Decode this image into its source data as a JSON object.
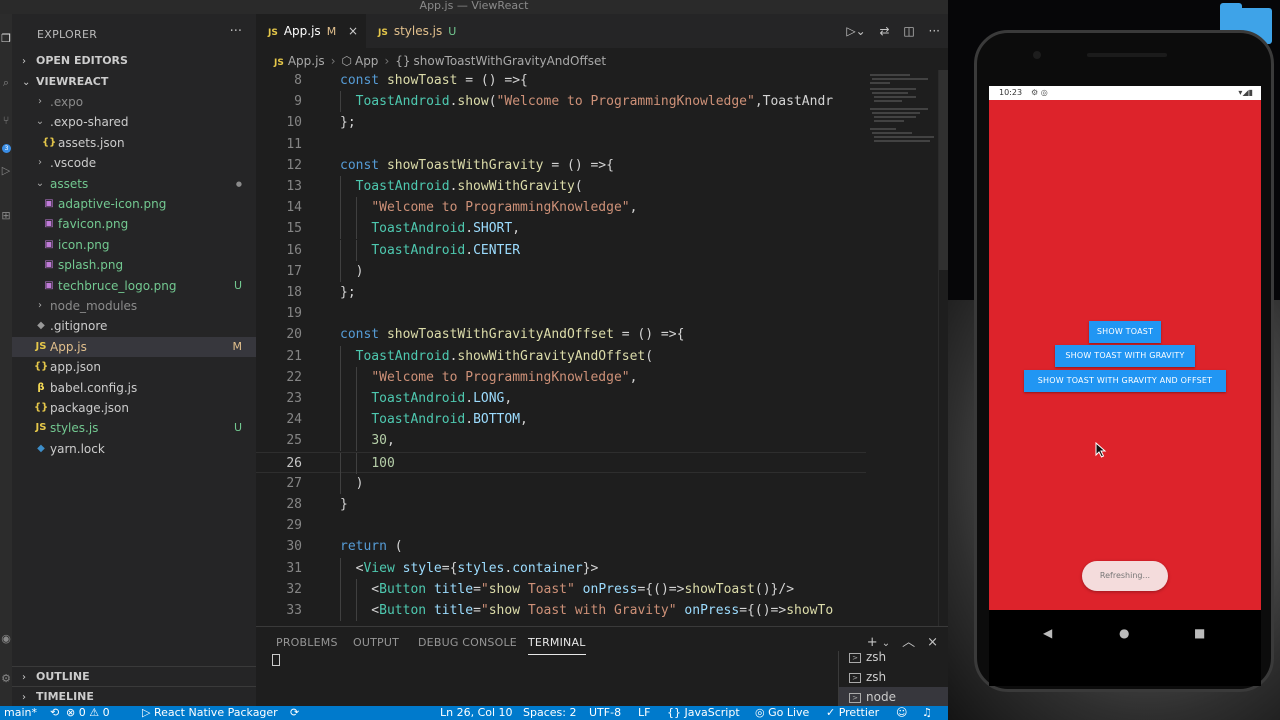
{
  "window_title": "App.js — ViewReact",
  "sidebar": {
    "header": "EXPLORER",
    "more": "···",
    "open_editors": "OPEN EDITORS",
    "project": "VIEWREACT",
    "tree": [
      {
        "name": ".expo",
        "icon": "›",
        "badge": ""
      },
      {
        "name": ".expo-shared",
        "icon": "⌄",
        "badge": ""
      },
      {
        "name": "assets.json",
        "icon": "{}",
        "badge": ""
      },
      {
        "name": ".vscode",
        "icon": "›",
        "badge": ""
      },
      {
        "name": "assets",
        "icon": "⌄",
        "badge": "●"
      },
      {
        "name": "adaptive-icon.png",
        "icon": "▣",
        "badge": ""
      },
      {
        "name": "favicon.png",
        "icon": "▣",
        "badge": ""
      },
      {
        "name": "icon.png",
        "icon": "▣",
        "badge": ""
      },
      {
        "name": "splash.png",
        "icon": "▣",
        "badge": ""
      },
      {
        "name": "techbruce_logo.png",
        "icon": "▣",
        "badge": "U"
      },
      {
        "name": "node_modules",
        "icon": "›",
        "badge": ""
      },
      {
        "name": ".gitignore",
        "icon": "◆",
        "badge": ""
      },
      {
        "name": "App.js",
        "icon": "JS",
        "badge": "M"
      },
      {
        "name": "app.json",
        "icon": "{}",
        "badge": ""
      },
      {
        "name": "babel.config.js",
        "icon": "β",
        "badge": ""
      },
      {
        "name": "package.json",
        "icon": "{}",
        "badge": ""
      },
      {
        "name": "styles.js",
        "icon": "JS",
        "badge": "U"
      },
      {
        "name": "yarn.lock",
        "icon": "◆",
        "badge": ""
      }
    ],
    "outline": "OUTLINE",
    "timeline": "TIMELINE"
  },
  "tabs": [
    {
      "icon": "JS",
      "label": "App.js",
      "mark": "M",
      "close": "×"
    },
    {
      "icon": "JS",
      "label": "styles.js",
      "mark": "U",
      "close": ""
    }
  ],
  "breadcrumb": {
    "icon": "JS",
    "file": "App.js",
    "sep1": "›",
    "sym1": "App",
    "sep2": "›",
    "sym2": "showToastWithGravityAndOffset"
  },
  "code": [
    {
      "n": "8",
      "t": "const showToast = () =>{"
    },
    {
      "n": "9",
      "t": "  ToastAndroid.show(\"Welcome to ProgrammingKnowledge\",ToastAndr"
    },
    {
      "n": "10",
      "t": "};"
    },
    {
      "n": "11",
      "t": ""
    },
    {
      "n": "12",
      "t": "const showToastWithGravity = () =>{"
    },
    {
      "n": "13",
      "t": "  ToastAndroid.showWithGravity("
    },
    {
      "n": "14",
      "t": "    \"Welcome to ProgrammingKnowledge\","
    },
    {
      "n": "15",
      "t": "    ToastAndroid.SHORT,"
    },
    {
      "n": "16",
      "t": "    ToastAndroid.CENTER"
    },
    {
      "n": "17",
      "t": "  )"
    },
    {
      "n": "18",
      "t": "};"
    },
    {
      "n": "19",
      "t": ""
    },
    {
      "n": "20",
      "t": "const showToastWithGravityAndOffset = () =>{"
    },
    {
      "n": "21",
      "t": "  ToastAndroid.showWithGravityAndOffset("
    },
    {
      "n": "22",
      "t": "    \"Welcome to ProgrammingKnowledge\","
    },
    {
      "n": "23",
      "t": "    ToastAndroid.LONG,"
    },
    {
      "n": "24",
      "t": "    ToastAndroid.BOTTOM,"
    },
    {
      "n": "25",
      "t": "    30,"
    },
    {
      "n": "26",
      "t": "    100"
    },
    {
      "n": "27",
      "t": "  )"
    },
    {
      "n": "28",
      "t": "}"
    },
    {
      "n": "29",
      "t": ""
    },
    {
      "n": "30",
      "t": "return ("
    },
    {
      "n": "31",
      "t": "  <View style={styles.container}>"
    },
    {
      "n": "32",
      "t": "    <Button title=\"show Toast\" onPress={()=>showToast()}/>"
    },
    {
      "n": "33",
      "t": "    <Button title=\"show Toast with Gravity\" onPress={()=>showTo"
    }
  ],
  "current_line": "26",
  "panel": {
    "tabs": [
      "PROBLEMS",
      "OUTPUT",
      "DEBUG CONSOLE",
      "TERMINAL"
    ],
    "active_tab": "TERMINAL",
    "actions": [
      "+",
      "⌄",
      "︿",
      "×"
    ],
    "terminals": [
      "zsh",
      "zsh",
      "node"
    ]
  },
  "statusbar": {
    "branch": "main*",
    "sync": "⟲",
    "errors": "⊗ 0 ⚠ 0",
    "packager": "▷ React Native Packager",
    "refresh": "⟳",
    "position": "Ln 26, Col 10",
    "spaces": "Spaces: 2",
    "encoding": "UTF-8",
    "eol": "LF",
    "language": "{} JavaScript",
    "golive": "◎ Go Live",
    "prettier": "✓ Prettier",
    "feedback": "☺",
    "bell": "♫"
  },
  "phone": {
    "time": "10:23",
    "status_icons": "⚙ ◎",
    "right_icons": "▾◢▮",
    "buttons": [
      "SHOW TOAST",
      "SHOW TOAST WITH GRAVITY",
      "SHOW TOAST WITH GRAVITY AND OFFSET"
    ],
    "refreshing": "Refreshing...",
    "nav": [
      "◀",
      "●",
      "■"
    ],
    "app_color": "#dd232b",
    "button_color": "#2196f3"
  }
}
